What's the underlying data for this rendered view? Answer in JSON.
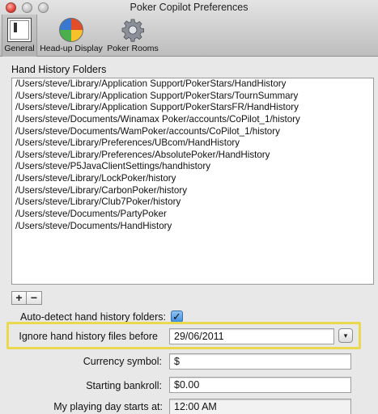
{
  "window": {
    "title": "Poker Copilot Preferences"
  },
  "toolbar": {
    "items": [
      {
        "label": "General",
        "icon": "general-settings-icon",
        "selected": true
      },
      {
        "label": "Head-up Display",
        "icon": "hud-icon",
        "selected": false
      },
      {
        "label": "Poker Rooms",
        "icon": "gear-icon",
        "selected": false
      }
    ]
  },
  "hand_history": {
    "section_label": "Hand History Folders",
    "folders": [
      "/Users/steve/Library/Application Support/PokerStars/HandHistory",
      "/Users/steve/Library/Application Support/PokerStars/TournSummary",
      "/Users/steve/Library/Application Support/PokerStarsFR/HandHistory",
      "/Users/steve/Documents/Winamax Poker/accounts/CoPilot_1/history",
      "/Users/steve/Documents/WamPoker/accounts/CoPilot_1/history",
      "/Users/steve/Library/Preferences/UBcom/HandHistory",
      "/Users/steve/Library/Preferences/AbsolutePoker/HandHistory",
      "/Users/steve/P5JavaClientSettings/handhistory",
      "/Users/steve/Library/LockPoker/history",
      "/Users/steve/Library/CarbonPoker/history",
      "/Users/steve/Library/Club7Poker/history",
      "/Users/steve/Documents/PartyPoker",
      "/Users/steve/Documents/HandHistory"
    ],
    "add_label": "+",
    "remove_label": "−"
  },
  "settings": {
    "auto_detect_label": "Auto-detect hand history folders:",
    "auto_detect_checked": true,
    "auto_detect_mark": "✓",
    "ignore_before_label": "Ignore hand history files before",
    "ignore_before_value": "29/06/2011",
    "ignore_before_stepper": "▾",
    "currency_label": "Currency symbol:",
    "currency_value": "$",
    "bankroll_label": "Starting bankroll:",
    "bankroll_value": "$0.00",
    "day_start_label": "My playing day starts at:",
    "day_start_value": "12:00 AM"
  },
  "colors": {
    "highlight": "#ead94f",
    "checkbox": "#3f8ee0"
  }
}
